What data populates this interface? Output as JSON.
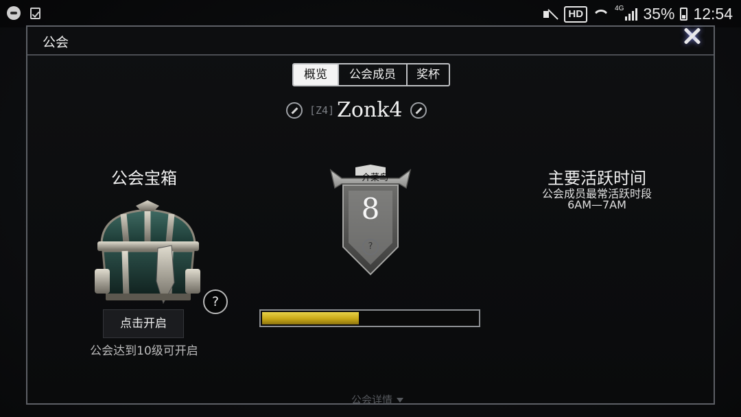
{
  "status_bar": {
    "hd": "HD",
    "network": "4G",
    "battery": "35%",
    "time": "12:54"
  },
  "panel": {
    "title": "公会"
  },
  "tabs": [
    {
      "label": "概览",
      "active": true
    },
    {
      "label": "公会成员",
      "active": false
    },
    {
      "label": "奖杯",
      "active": false
    }
  ],
  "guild": {
    "tag": "[Z4]",
    "name": "Zonk4"
  },
  "chest": {
    "title": "公会宝箱",
    "open_button": "点击开启",
    "help": "?",
    "note": "公会达到10级可开启"
  },
  "rank": {
    "title": "一介菜鸟",
    "level": "8",
    "help": "?",
    "progress_fraction": 0.45
  },
  "activity": {
    "title": "主要活跃时间",
    "subtitle": "公会成员最常活跃时段",
    "time_range": "6AM—7AM"
  },
  "footer": {
    "details_label": "公会详情"
  },
  "colors": {
    "xp_fill": "#c9a917",
    "panel_border": "#5d6066",
    "tab_active_bg": "#f4f4f4"
  },
  "icons": {
    "close": "close-icon",
    "edit": "pencil-icon",
    "help": "question-icon",
    "chest": "treasure-chest-icon",
    "rank": "banner-shield-icon"
  }
}
